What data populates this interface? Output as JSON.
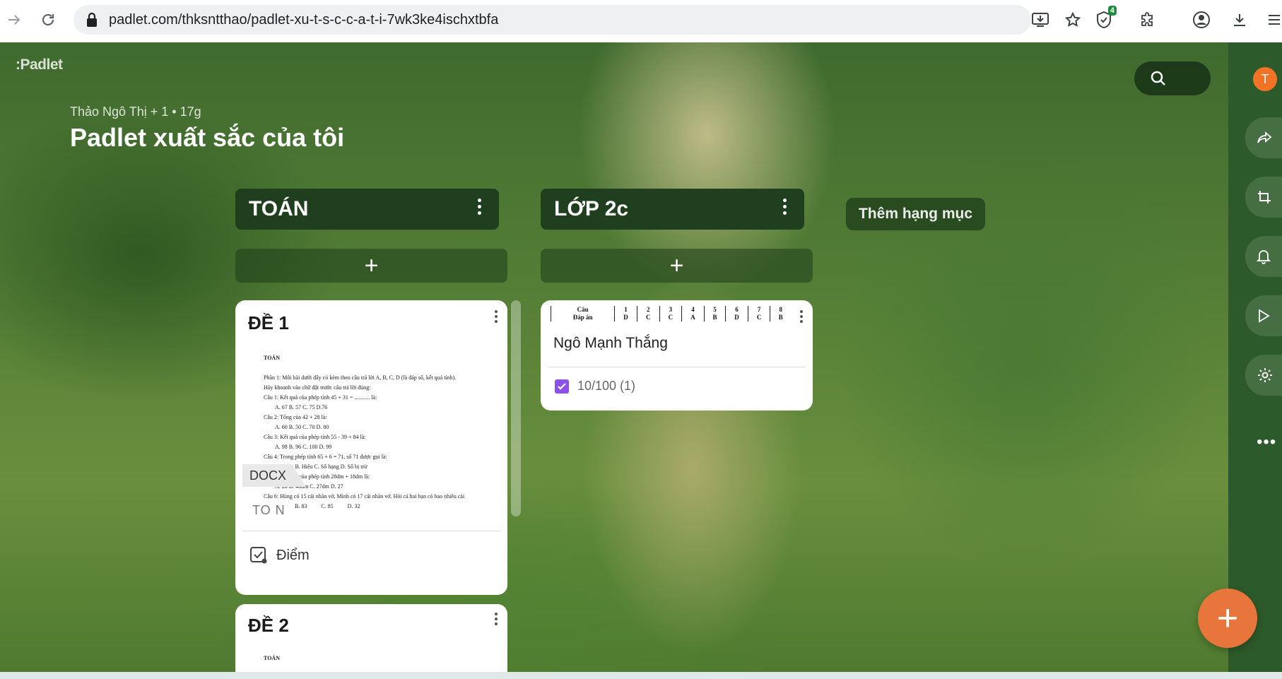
{
  "browser": {
    "url": "padlet.com/thksntthao/padlet-xu-t-s-c-c-a-t-i-7wk3ke4ischxtbfa",
    "extension_badge": "4"
  },
  "board": {
    "logo": ":Padlet",
    "author": "Thảo Ngô Thị + 1",
    "time": "17g",
    "title": "Padlet xuất sắc của tôi",
    "add_category": "Thêm hạng mục",
    "avatar_letter": "T"
  },
  "columns": [
    {
      "title": "TOÁN",
      "cards": [
        {
          "title": "ĐỀ 1",
          "doc_heading": "TOÁN",
          "doc_lines": [
            "Phần 1: Mỗi bài dưới đây có kèm theo câu trả lời A, B, C, D (là đáp số, kết quả tính).",
            "Hãy khoanh vào chữ đặt trước câu trả lời đúng:",
            "Câu 1: Kết quả của phép tính 45 + 31 = ........... là:",
            "A. 67          B. 57          C. 75          D.76",
            "Câu 2: Tổng của 42 + 28 là:",
            "A. 60          B. 50          C. 70          D. 80",
            "Câu 3: Kết quả của phép tính 55 - 39 + 84 là:",
            "A. 98          B. 96          C. 100          D. 99",
            "Câu 4: Trong phép tính 65 + 6 = 71, số 71 được gọi là:",
            "A. Tổng        B. Hiệu        C. Số hạng        D. Số bị trừ",
            "Câu 5: Kết quả của phép tính 28dm + 18dm là:",
            "A. 28          B. 46dm          C. 27dm          D. 27",
            "Câu 6: Hùng có 15 cái nhãn vở, Minh có 17 cái nhãn vở. Hỏi cả hai bạn có bao nhiêu cái",
            "                      B. 83          C. 85          D. 32"
          ],
          "file_type": "DOCX",
          "subtitle": "TO N",
          "grade_label": "Điểm"
        },
        {
          "title": "ĐỀ 2",
          "doc_heading": "TOÁN"
        }
      ]
    },
    {
      "title": "LỚP 2c",
      "cards": [
        {
          "answer_header": [
            "Câu",
            "1",
            "2",
            "3",
            "4",
            "5",
            "6",
            "7",
            "8"
          ],
          "answer_row": [
            "Đáp án",
            "D",
            "C",
            "C",
            "A",
            "B",
            "D",
            "C",
            "B"
          ],
          "author": "Ngô Mạnh Thắng",
          "score": "10/100 (1)"
        }
      ]
    }
  ]
}
